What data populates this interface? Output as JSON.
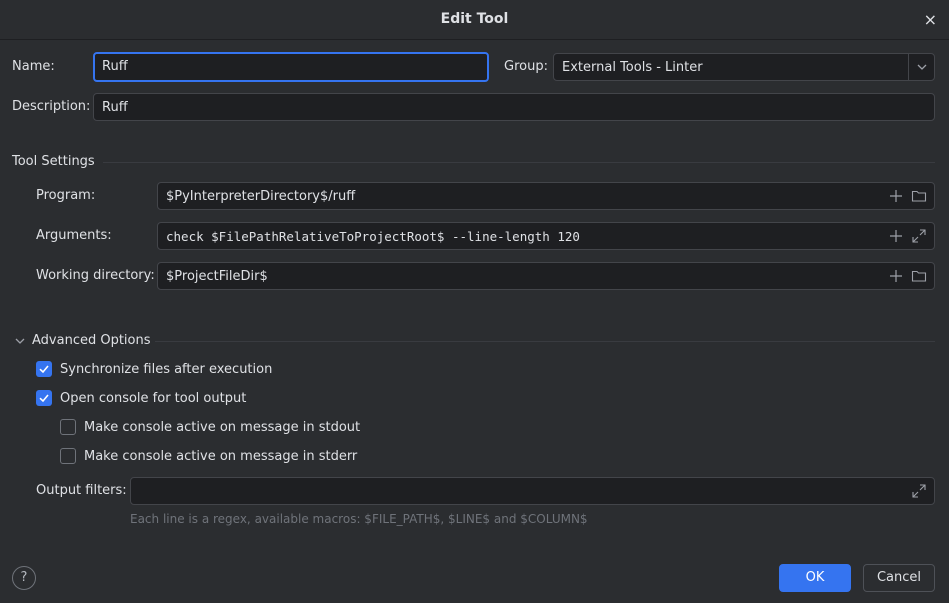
{
  "dialog": {
    "title": "Edit Tool",
    "close_glyph": "×"
  },
  "name": {
    "label": "Name:",
    "value": "Ruff"
  },
  "group": {
    "label": "Group:",
    "value": "External Tools - Linter"
  },
  "description": {
    "label": "Description:",
    "value": "Ruff"
  },
  "tool_settings": {
    "heading": "Tool Settings",
    "program": {
      "label": "Program:",
      "value": "$PyInterpreterDirectory$/ruff"
    },
    "arguments": {
      "label": "Arguments:",
      "value": "check $FilePathRelativeToProjectRoot$ --line-length 120"
    },
    "working_directory": {
      "label": "Working directory:",
      "value": "$ProjectFileDir$"
    }
  },
  "advanced": {
    "heading": "Advanced Options",
    "sync_files": {
      "label": "Synchronize files after execution",
      "checked": true
    },
    "open_console": {
      "label": "Open console for tool output",
      "checked": true
    },
    "console_stdout": {
      "label": "Make console active on message in stdout",
      "checked": false
    },
    "console_stderr": {
      "label": "Make console active on message in stderr",
      "checked": false
    },
    "output_filters": {
      "label": "Output filters:",
      "value": "",
      "hint": "Each line is a regex, available macros: $FILE_PATH$, $LINE$ and $COLUMN$"
    }
  },
  "footer": {
    "help_glyph": "?",
    "ok_label": "OK",
    "cancel_label": "Cancel"
  },
  "colors": {
    "accent": "#3574f0",
    "background": "#2b2d30",
    "field_bg": "#1e1f22"
  }
}
